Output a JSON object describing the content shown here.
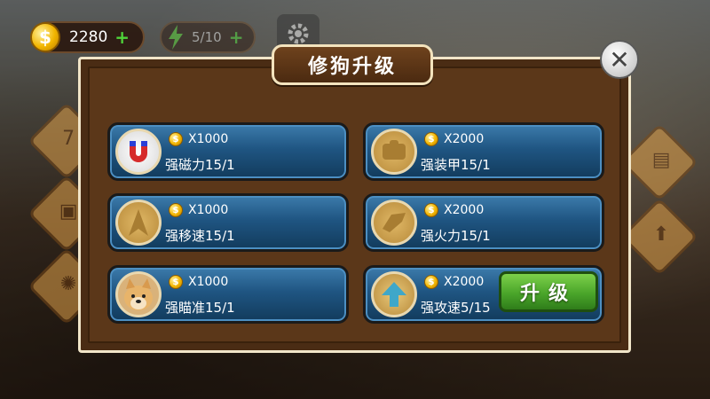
{
  "hud": {
    "coins": "2280",
    "coin_symbol": "$",
    "energy": "5/10",
    "plus": "+"
  },
  "panel": {
    "title": "修狗升级",
    "close_symbol": "✕"
  },
  "upgrades": [
    {
      "price": "X1000",
      "name": "强磁力15/1",
      "icon": "magnet-icon"
    },
    {
      "price": "X2000",
      "name": "强装甲15/1",
      "icon": "armor-icon"
    },
    {
      "price": "X1000",
      "name": "强移速15/1",
      "icon": "speed-icon"
    },
    {
      "price": "X2000",
      "name": "强火力15/1",
      "icon": "firepower-icon"
    },
    {
      "price": "X1000",
      "name": "强瞄准15/1",
      "icon": "doge-icon"
    },
    {
      "price": "X2000",
      "name": "强攻速5/15",
      "icon": "arrow-up-icon"
    }
  ],
  "upgrade_button": "升级",
  "side": {
    "calendar_label": "7"
  },
  "colors": {
    "card_blue": "#1f5582",
    "panel_brown": "#5b3719",
    "button_green": "#4aa52a"
  }
}
